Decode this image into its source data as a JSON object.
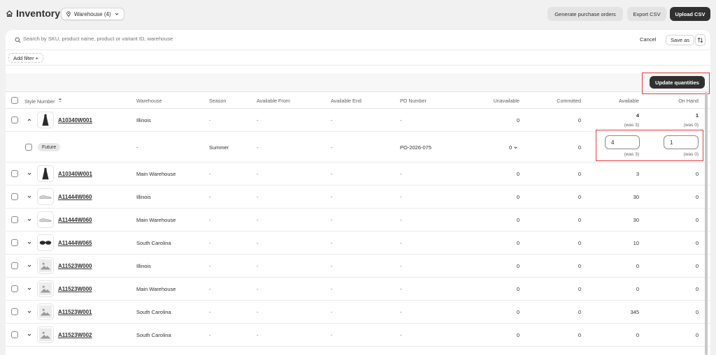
{
  "header": {
    "title": "Inventory",
    "location_select": "Warehouse (4)",
    "generate_po": "Generate purchase orders",
    "export_csv": "Export CSV",
    "upload_csv": "Upload CSV"
  },
  "search": {
    "placeholder": "Search by SKU, product name, product or variant ID, warehouse",
    "cancel": "Cancel",
    "save_as": "Save as"
  },
  "filters": {
    "add_filter": "Add filter +"
  },
  "bulk": {
    "update_quantities": "Update quantities"
  },
  "columns": {
    "style_number": "Style Number",
    "warehouse": "Warehouse",
    "season": "Season",
    "available_from": "Available From",
    "available_end": "Available End",
    "po_number": "PO Number",
    "unavailable": "Unavailable",
    "committed": "Committed",
    "available": "Available",
    "on_hand": "On Hand"
  },
  "rows": [
    {
      "sku": "A10340W001",
      "warehouse": "Illinois",
      "season": "-",
      "available_from": "-",
      "available_end": "-",
      "po_number": "-",
      "unavailable": "0",
      "committed": "0",
      "available": "4",
      "available_was": "(was 3)",
      "on_hand": "1",
      "on_hand_was": "(was 0)",
      "thumb": "dress-icon",
      "expanded": true
    },
    {
      "sku": "A10340W001",
      "warehouse": "Main Warehouse",
      "season": "-",
      "available_from": "-",
      "available_end": "-",
      "po_number": "-",
      "unavailable": "0",
      "committed": "0",
      "available": "3",
      "on_hand": "0",
      "thumb": "dress-icon"
    },
    {
      "sku": "A11444W060",
      "warehouse": "Illinois",
      "season": "-",
      "available_from": "-",
      "available_end": "-",
      "po_number": "-",
      "unavailable": "0",
      "committed": "0",
      "available": "30",
      "on_hand": "0",
      "thumb": "shoe-icon"
    },
    {
      "sku": "A11444W060",
      "warehouse": "Main Warehouse",
      "season": "-",
      "available_from": "-",
      "available_end": "-",
      "po_number": "-",
      "unavailable": "0",
      "committed": "0",
      "available": "30",
      "on_hand": "0",
      "thumb": "shoe-icon"
    },
    {
      "sku": "A11444W065",
      "warehouse": "South Carolina",
      "season": "-",
      "available_from": "-",
      "available_end": "-",
      "po_number": "-",
      "unavailable": "0",
      "committed": "0",
      "available": "10",
      "on_hand": "0",
      "thumb": "sunglasses-icon"
    },
    {
      "sku": "A11523W000",
      "warehouse": "Illinois",
      "season": "-",
      "available_from": "-",
      "available_end": "-",
      "po_number": "-",
      "unavailable": "0",
      "committed": "0",
      "available": "0",
      "on_hand": "0",
      "thumb": "image-placeholder-icon"
    },
    {
      "sku": "A11523W000",
      "warehouse": "Main Warehouse",
      "season": "-",
      "available_from": "-",
      "available_end": "-",
      "po_number": "-",
      "unavailable": "0",
      "committed": "0",
      "available": "0",
      "on_hand": "0",
      "thumb": "image-placeholder-icon"
    },
    {
      "sku": "A11523W001",
      "warehouse": "South Carolina",
      "season": "-",
      "available_from": "-",
      "available_end": "-",
      "po_number": "-",
      "unavailable": "0",
      "committed": "0",
      "available": "345",
      "on_hand": "0",
      "thumb": "image-placeholder-icon"
    },
    {
      "sku": "A11523W002",
      "warehouse": "South Carolina",
      "season": "-",
      "available_from": "-",
      "available_end": "-",
      "po_number": "-",
      "unavailable": "0",
      "committed": "0",
      "available": "0",
      "on_hand": "0",
      "thumb": "image-placeholder-icon"
    }
  ],
  "subrow": {
    "tag": "Future",
    "warehouse": "-",
    "season": "Summer",
    "available_from": "-",
    "available_end": "-",
    "po_number": "PO-2026-075",
    "unavailable": "0",
    "committed": "0",
    "available_input": "4",
    "available_was": "(was 3)",
    "on_hand_input": "1",
    "on_hand_was": "(was 0)"
  },
  "colors": {
    "accent": "#303030",
    "highlight": "#e33c3c",
    "background": "#f1f1f1"
  }
}
